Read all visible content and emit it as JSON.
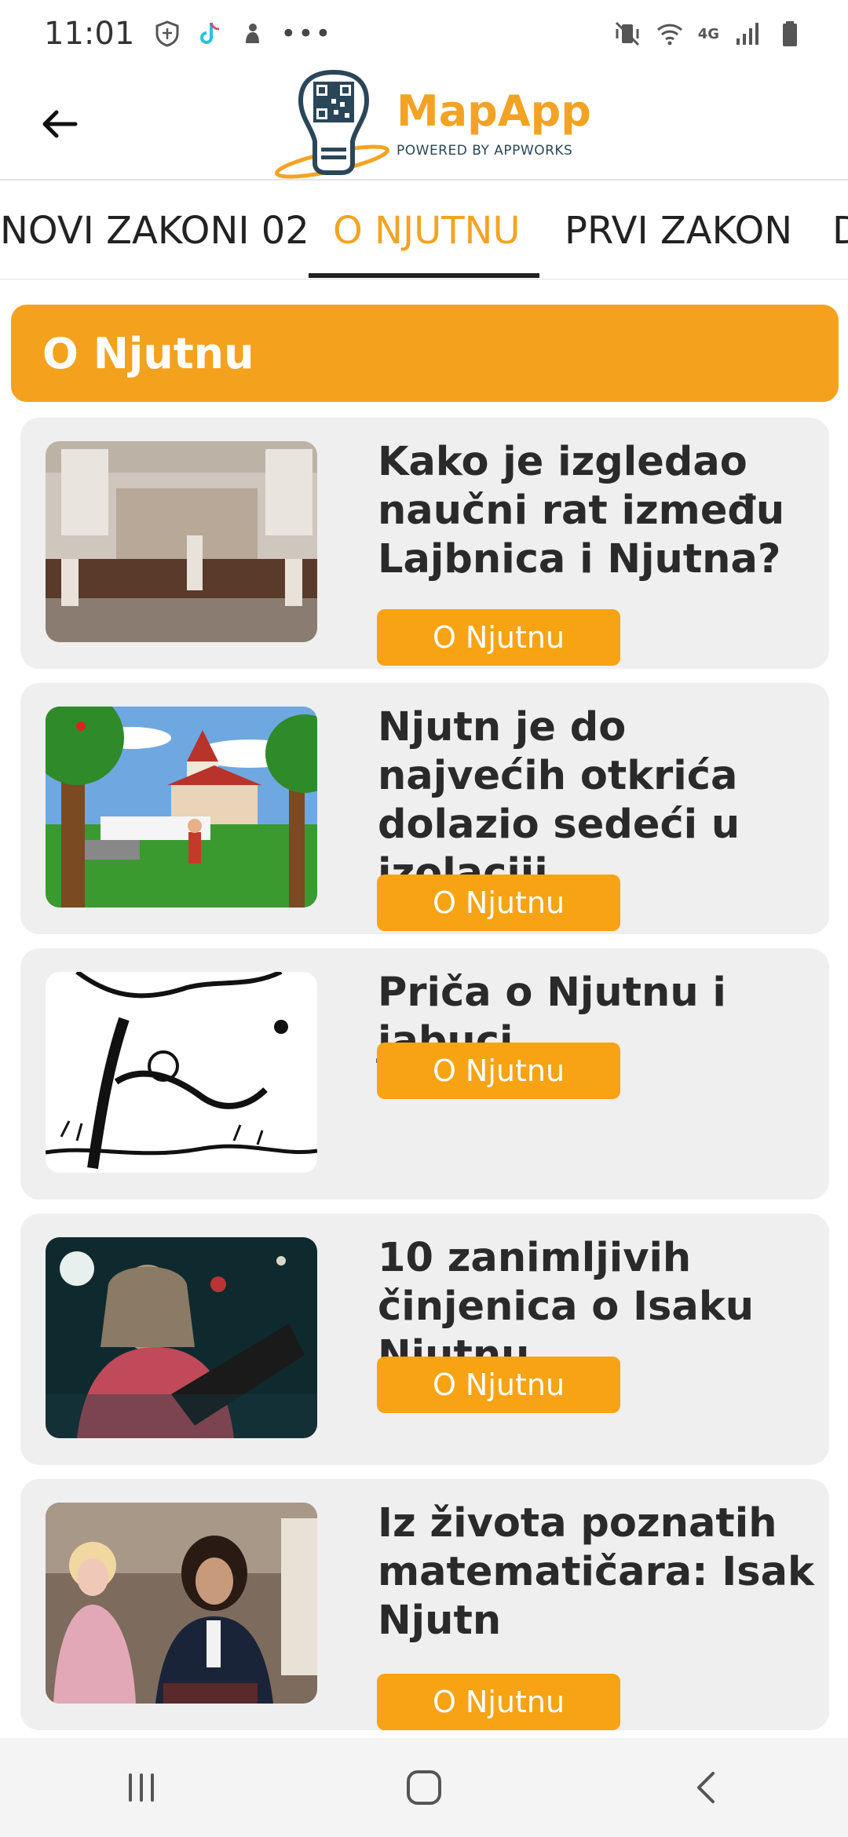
{
  "status_bar": {
    "time": "11:01",
    "network": "4G"
  },
  "header": {
    "app_name": "MapApp",
    "tagline": "POWERED BY APPWORKS"
  },
  "tabs": [
    {
      "label": "NOVI ZAKONI 02"
    },
    {
      "label": "O NJUTNU"
    },
    {
      "label": "PRVI ZAKON"
    },
    {
      "label": "D"
    }
  ],
  "section": {
    "title": "O Njutnu"
  },
  "articles": [
    {
      "title": "Kako je izgledao naučni rat između Lajbnica i Njutna?",
      "category": "O Njutnu"
    },
    {
      "title": "Njutn je do najvećih otkrića dolazio sedeći u izolaciji",
      "category": "O Njutnu"
    },
    {
      "title": "Priča o Njutnu i jabuci",
      "category": "O Njutnu"
    },
    {
      "title": "10 zanimljivih činjenica o Isaku Njutnu",
      "category": "O Njutnu"
    },
    {
      "title": "Iz života poznatih matematičara: Isak Njutn",
      "category": "O Njutnu"
    }
  ],
  "colors": {
    "accent": "#f4a21d",
    "button": "#f7a314",
    "card_bg": "#efefef"
  }
}
